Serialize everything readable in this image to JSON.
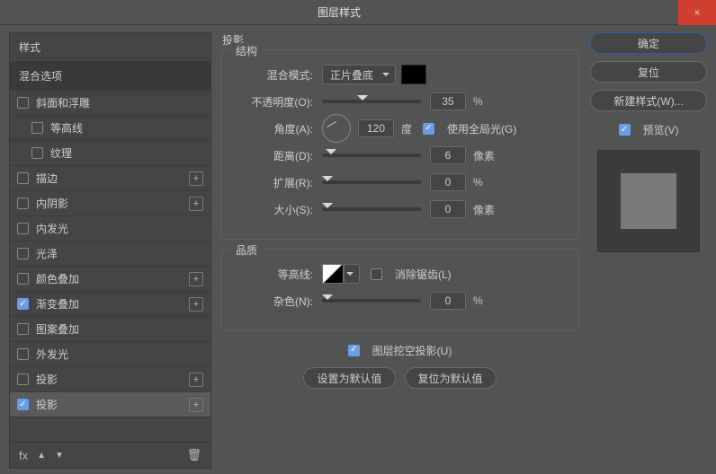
{
  "window": {
    "title": "图层样式",
    "close": "×"
  },
  "sidebar_left": {
    "header": "样式",
    "blending": "混合选项",
    "items": [
      {
        "label": "斜面和浮雕",
        "checked": false,
        "indent": false,
        "plus": false
      },
      {
        "label": "等高线",
        "checked": false,
        "indent": true,
        "plus": false
      },
      {
        "label": "纹理",
        "checked": false,
        "indent": true,
        "plus": false
      },
      {
        "label": "描边",
        "checked": false,
        "indent": false,
        "plus": true
      },
      {
        "label": "内阴影",
        "checked": false,
        "indent": false,
        "plus": true
      },
      {
        "label": "内发光",
        "checked": false,
        "indent": false,
        "plus": false
      },
      {
        "label": "光泽",
        "checked": false,
        "indent": false,
        "plus": false
      },
      {
        "label": "颜色叠加",
        "checked": false,
        "indent": false,
        "plus": true
      },
      {
        "label": "渐变叠加",
        "checked": true,
        "indent": false,
        "plus": true
      },
      {
        "label": "图案叠加",
        "checked": false,
        "indent": false,
        "plus": false
      },
      {
        "label": "外发光",
        "checked": false,
        "indent": false,
        "plus": false
      },
      {
        "label": "投影",
        "checked": false,
        "indent": false,
        "plus": true
      },
      {
        "label": "投影",
        "checked": true,
        "indent": false,
        "plus": true,
        "active": true
      }
    ],
    "footer": {
      "fx": "fx",
      "up": "▲",
      "down": "▼",
      "trash": "🗑"
    }
  },
  "center": {
    "heading": "投影",
    "structure": {
      "legend": "结构",
      "blend_label": "混合模式:",
      "blend_value": "正片叠底",
      "opacity_label": "不透明度(O):",
      "opacity_value": "35",
      "opacity_unit": "%",
      "angle_label": "角度(A):",
      "angle_value": "120",
      "angle_unit": "度",
      "global_label": "使用全局光(G)",
      "global_checked": true,
      "distance_label": "距离(D):",
      "distance_value": "6",
      "distance_unit": "像素",
      "spread_label": "扩展(R):",
      "spread_value": "0",
      "spread_unit": "%",
      "size_label": "大小(S):",
      "size_value": "0",
      "size_unit": "像素"
    },
    "quality": {
      "legend": "品质",
      "contour_label": "等高线:",
      "antialias_label": "消除锯齿(L)",
      "antialias_checked": false,
      "noise_label": "杂色(N):",
      "noise_value": "0",
      "noise_unit": "%"
    },
    "knockout": {
      "label": "图层挖空投影(U)",
      "checked": true
    },
    "buttons": {
      "default": "设置为默认值",
      "reset": "复位为默认值"
    }
  },
  "sidebar_right": {
    "ok": "确定",
    "cancel": "复位",
    "new_style": "新建样式(W)...",
    "preview_label": "预览(V)",
    "preview_checked": true
  }
}
